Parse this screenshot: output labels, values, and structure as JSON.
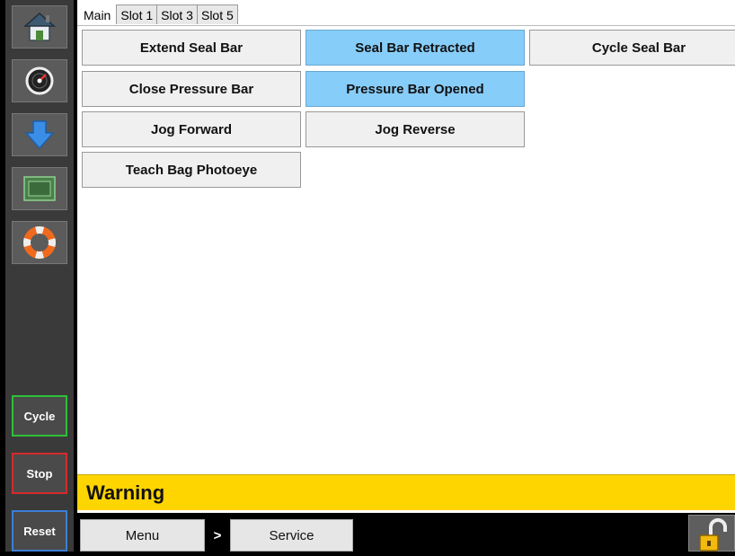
{
  "sidebar": {
    "icons": [
      "home-icon",
      "gauge-icon",
      "download-arrow-icon",
      "cpu-chip-icon",
      "lifebuoy-icon"
    ],
    "actions": [
      {
        "label": "Cycle",
        "color": "#2fbf3a"
      },
      {
        "label": "Stop",
        "color": "#d42b2b"
      },
      {
        "label": "Reset",
        "color": "#3b7fd6"
      }
    ]
  },
  "tabs": [
    "Main",
    "Slot 1",
    "Slot 3",
    "Slot 5"
  ],
  "active_tab": "Main",
  "commands": [
    {
      "label": "Extend Seal Bar",
      "active": false
    },
    {
      "label": "Seal Bar Retracted",
      "active": true
    },
    {
      "label": "Cycle Seal Bar",
      "active": false
    },
    {
      "label": "Close Pressure Bar",
      "active": false
    },
    {
      "label": "Pressure Bar Opened",
      "active": true
    },
    {
      "label": "Jog Forward",
      "active": false
    },
    {
      "label": "Jog Reverse",
      "active": false
    },
    {
      "label": "Teach Bag Photoeye",
      "active": false
    }
  ],
  "status": {
    "text": "Warning",
    "color": "#ffd500"
  },
  "nav": {
    "menu": "Menu",
    "separator": ">",
    "current": "Service"
  },
  "lock_icon": "unlocked-padlock-icon",
  "colors": {
    "active_button": "#87cdf9",
    "sidebar": "#3a3a3a"
  }
}
